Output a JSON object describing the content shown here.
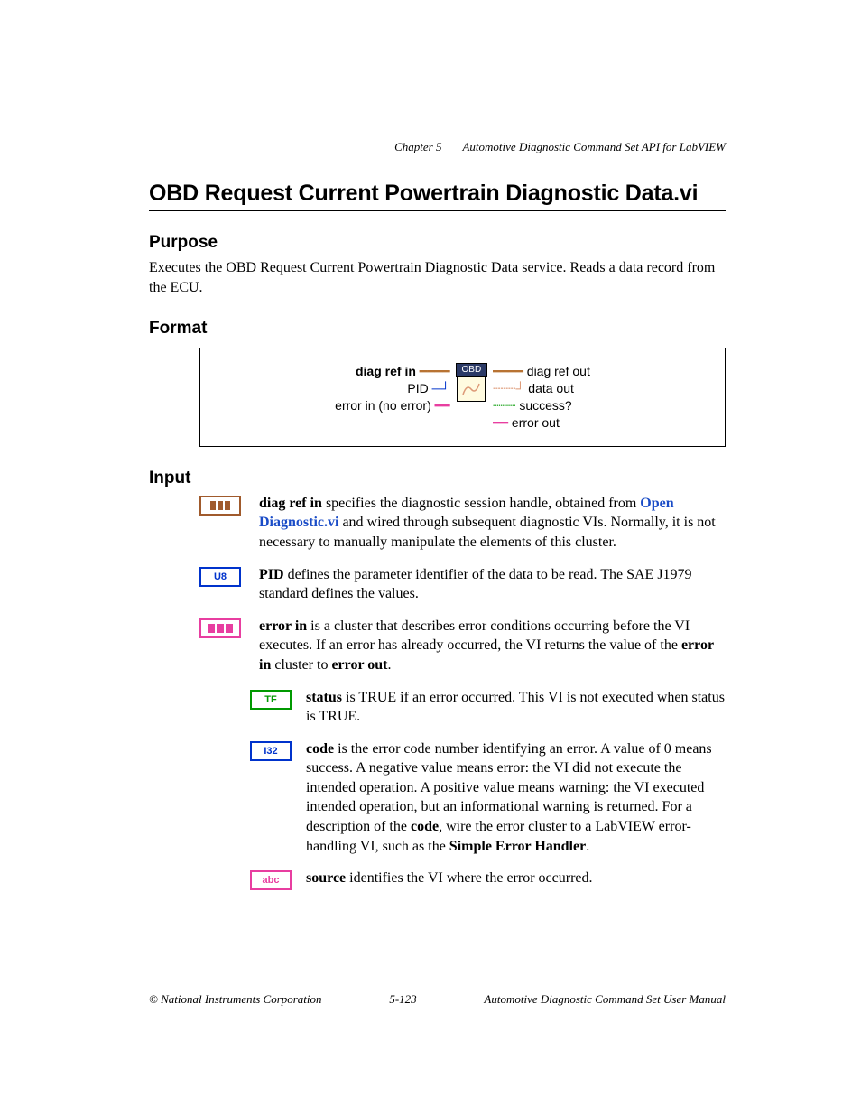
{
  "header": {
    "chapter": "Chapter 5",
    "title": "Automotive Diagnostic Command Set API for LabVIEW"
  },
  "page_title": "OBD Request Current Powertrain Diagnostic Data.vi",
  "sections": {
    "purpose": {
      "heading": "Purpose",
      "text": "Executes the OBD Request Current Powertrain Diagnostic Data service. Reads a data record from the ECU."
    },
    "format": {
      "heading": "Format",
      "diagram": {
        "left": {
          "l1": "diag ref in",
          "l2": "PID",
          "l3": "error in (no error)"
        },
        "node_label": "OBD",
        "right": {
          "r1": "diag ref out",
          "r2": "data out",
          "r3": "success?",
          "r4": "error out"
        }
      }
    },
    "input": {
      "heading": "Input",
      "items": {
        "diag_ref_in": {
          "name": "diag ref in",
          "text_before_link": " specifies the diagnostic session handle, obtained from ",
          "link": "Open Diagnostic.vi",
          "text_after_link": " and wired through subsequent diagnostic VIs. Normally, it is not necessary to manually manipulate the elements of this cluster."
        },
        "pid": {
          "name": "PID",
          "text": " defines the parameter identifier of the data to be read. The SAE J1979 standard defines the values.",
          "icon_label": "U8"
        },
        "error_in": {
          "name": "error in",
          "text_part1": " is a cluster that describes error conditions occurring before the VI executes. If an error has already occurred, the VI returns the value of the ",
          "bold1": "error in",
          "text_part2": " cluster to ",
          "bold2": "error out",
          "text_part3": "."
        },
        "status": {
          "name": "status",
          "text": " is TRUE if an error occurred. This VI is not executed when status is TRUE.",
          "icon_label": "TF"
        },
        "code": {
          "name": "code",
          "text_part1": " is the error code number identifying an error. A value of 0 means success. A negative value means error: the VI did not execute the intended operation. A positive value means warning: the VI executed intended operation, but an informational warning is returned. For a description of the ",
          "bold1": "code",
          "text_part2": ", wire the error cluster to a LabVIEW error-handling VI, such as the ",
          "bold2": "Simple Error Handler",
          "text_part3": ".",
          "icon_label": "I32"
        },
        "source": {
          "name": "source",
          "text": " identifies the VI where the error occurred.",
          "icon_label": "abc"
        }
      }
    }
  },
  "footer": {
    "left": "© National Instruments Corporation",
    "center": "5-123",
    "right": "Automotive Diagnostic Command Set User Manual"
  }
}
